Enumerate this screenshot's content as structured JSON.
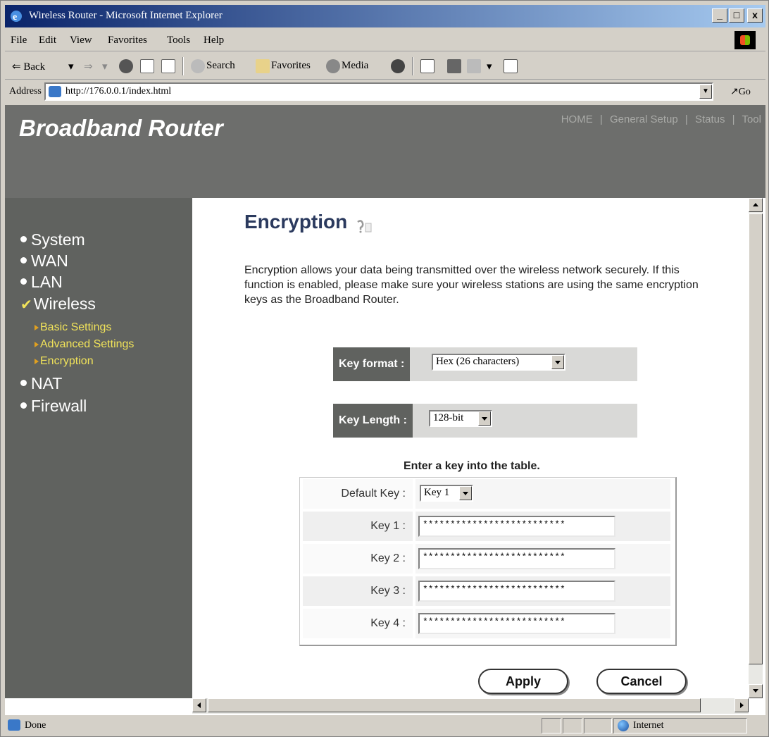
{
  "window": {
    "title": "Wireless Router - Microsoft Internet Explorer",
    "minimize": "_",
    "maximize": "□",
    "close": "x"
  },
  "menu": [
    "File",
    "Edit",
    "View",
    "Favorites",
    "Tools",
    "Help"
  ],
  "toolbar": {
    "back": "⇐ Back",
    "search": "Search",
    "favorites": "Favorites",
    "media": "Media"
  },
  "address": {
    "label": "Address",
    "url": "http://176.0.0.1/index.html",
    "go": "Go"
  },
  "header": {
    "brand": "Broadband Router",
    "nav": [
      "HOME",
      "General Setup",
      "Status",
      "Tool"
    ],
    "nav_separator": "|"
  },
  "sidebar": {
    "items": [
      "System",
      "WAN",
      "LAN",
      "Wireless",
      "NAT",
      "Firewall"
    ],
    "active_item": "Wireless",
    "subitems": [
      "Basic Settings",
      "Advanced Settings",
      "Encryption"
    ],
    "active_subitem": "Encryption"
  },
  "page": {
    "title": "Encryption",
    "description": "Encryption allows your data being transmitted over the wireless network securely. If this function is enabled, please make sure your wireless stations are using the same encryption keys as the Broadband Router."
  },
  "key_format": {
    "label": "Key format :",
    "value": "Hex (26 characters)"
  },
  "key_length": {
    "label": "Key Length :",
    "value": "128-bit"
  },
  "key_table": {
    "caption": "Enter a key into the table.",
    "default_key_label": "Default Key :",
    "default_key_value": "Key 1",
    "keys": [
      {
        "label": "Key 1 :",
        "value": "**************************"
      },
      {
        "label": "Key 2 :",
        "value": "**************************"
      },
      {
        "label": "Key 3 :",
        "value": "**************************"
      },
      {
        "label": "Key 4 :",
        "value": "**************************"
      }
    ]
  },
  "buttons": {
    "apply": "Apply",
    "cancel": "Cancel"
  },
  "status": {
    "text": "Done",
    "zone": "Internet"
  },
  "colors": {
    "header_bg": "#6d6e6c",
    "sidebar_bg": "#60625f",
    "submenu_text": "#f1e35a",
    "title_text": "#2b3a5e"
  }
}
